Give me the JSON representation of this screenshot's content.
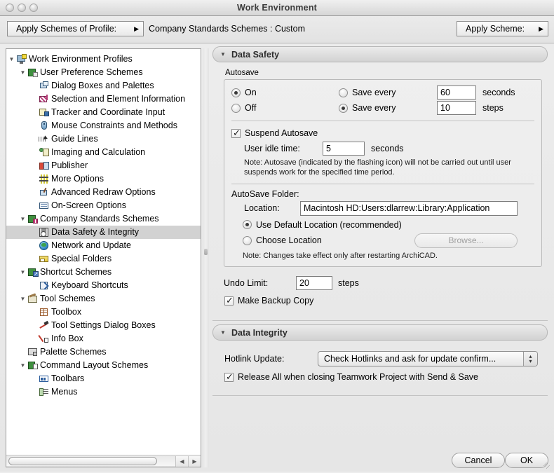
{
  "window": {
    "title": "Work Environment"
  },
  "toolbar": {
    "profile_button": "Apply Schemes of Profile:",
    "status": "Company Standards Schemes : Custom",
    "scheme_button": "Apply Scheme:"
  },
  "tree": {
    "items": [
      {
        "label": "Work Environment Profiles",
        "depth": 0,
        "twisty": "▼",
        "icon": "monitor-icon",
        "selected": false
      },
      {
        "label": "User Preference Schemes",
        "depth": 1,
        "twisty": "▼",
        "icon": "scheme-green-icon",
        "selected": false
      },
      {
        "label": "Dialog Boxes and Palettes",
        "depth": 2,
        "twisty": "",
        "icon": "dialog-boxes-icon",
        "selected": false
      },
      {
        "label": "Selection and Element Information",
        "depth": 2,
        "twisty": "",
        "icon": "selection-icon",
        "selected": false
      },
      {
        "label": "Tracker and Coordinate Input",
        "depth": 2,
        "twisty": "",
        "icon": "tracker-icon",
        "selected": false
      },
      {
        "label": "Mouse Constraints and Methods",
        "depth": 2,
        "twisty": "",
        "icon": "mouse-icon",
        "selected": false
      },
      {
        "label": "Guide Lines",
        "depth": 2,
        "twisty": "",
        "icon": "guide-lines-icon",
        "selected": false
      },
      {
        "label": "Imaging and Calculation",
        "depth": 2,
        "twisty": "",
        "icon": "imaging-icon",
        "selected": false
      },
      {
        "label": "Publisher",
        "depth": 2,
        "twisty": "",
        "icon": "publisher-icon",
        "selected": false
      },
      {
        "label": "More Options",
        "depth": 2,
        "twisty": "",
        "icon": "more-options-icon",
        "selected": false
      },
      {
        "label": "Advanced Redraw Options",
        "depth": 2,
        "twisty": "",
        "icon": "redraw-icon",
        "selected": false
      },
      {
        "label": "On-Screen Options",
        "depth": 2,
        "twisty": "",
        "icon": "on-screen-icon",
        "selected": false
      },
      {
        "label": "Company Standards Schemes",
        "depth": 1,
        "twisty": "▼",
        "icon": "scheme-pink-icon",
        "selected": false
      },
      {
        "label": "Data Safety & Integrity",
        "depth": 2,
        "twisty": "",
        "icon": "data-safety-icon",
        "selected": true
      },
      {
        "label": "Network and Update",
        "depth": 2,
        "twisty": "",
        "icon": "globe-icon",
        "selected": false
      },
      {
        "label": "Special Folders",
        "depth": 2,
        "twisty": "",
        "icon": "folder-icon",
        "selected": false
      },
      {
        "label": "Shortcut Schemes",
        "depth": 1,
        "twisty": "▼",
        "icon": "shortcut-scheme-icon",
        "selected": false
      },
      {
        "label": "Keyboard Shortcuts",
        "depth": 2,
        "twisty": "",
        "icon": "keyboard-shortcut-icon",
        "selected": false
      },
      {
        "label": "Tool Schemes",
        "depth": 1,
        "twisty": "▼",
        "icon": "tool-schemes-icon",
        "selected": false
      },
      {
        "label": "Toolbox",
        "depth": 2,
        "twisty": "",
        "icon": "toolbox-icon",
        "selected": false
      },
      {
        "label": "Tool Settings Dialog Boxes",
        "depth": 2,
        "twisty": "",
        "icon": "hammer-icon",
        "selected": false
      },
      {
        "label": "Info Box",
        "depth": 2,
        "twisty": "",
        "icon": "info-box-icon",
        "selected": false
      },
      {
        "label": "Palette Schemes",
        "depth": 1,
        "twisty": "",
        "icon": "palette-icon",
        "selected": false
      },
      {
        "label": "Command Layout Schemes",
        "depth": 1,
        "twisty": "▼",
        "icon": "command-layout-icon",
        "selected": false
      },
      {
        "label": "Toolbars",
        "depth": 2,
        "twisty": "",
        "icon": "toolbars-icon",
        "selected": false
      },
      {
        "label": "Menus",
        "depth": 2,
        "twisty": "",
        "icon": "menus-icon",
        "selected": false
      }
    ],
    "scroll_left_arrow": "◀",
    "scroll_right_arrow": "▶"
  },
  "data_safety": {
    "header": "Data Safety",
    "triangle": "▼",
    "autosave_group_label": "Autosave",
    "on_label": "On",
    "off_label": "Off",
    "save_every_seconds_label": "Save every",
    "seconds_value": "60",
    "seconds_unit": "seconds",
    "save_every_steps_label": "Save every",
    "steps_value": "10",
    "steps_unit": "steps",
    "suspend_autosave_label": "Suspend Autosave",
    "user_idle_label": "User idle time:",
    "user_idle_value": "5",
    "user_idle_unit": "seconds",
    "autosave_note": "Note: Autosave (indicated by the flashing icon) will not be carried out until user suspends work for the specified time period.",
    "folder_group_label": "AutoSave Folder:",
    "location_label": "Location:",
    "location_value": "Macintosh HD:Users:dlarrew:Library:Application",
    "use_default_label": "Use Default Location (recommended)",
    "choose_location_label": "Choose Location",
    "browse_label": "Browse...",
    "folder_note": "Note: Changes take effect only after restarting ArchiCAD.",
    "undo_limit_label": "Undo Limit:",
    "undo_limit_value": "20",
    "undo_limit_unit": "steps",
    "make_backup_label": "Make Backup Copy"
  },
  "data_integrity": {
    "header": "Data Integrity",
    "triangle": "▼",
    "hotlink_label": "Hotlink Update:",
    "hotlink_value": "Check Hotlinks and ask for update confirm...",
    "release_all_label": "Release All when closing Teamwork Project with Send & Save",
    "stepper_up": "▴",
    "stepper_down": "▾"
  },
  "footer": {
    "cancel_label": "Cancel",
    "ok_label": "OK"
  }
}
